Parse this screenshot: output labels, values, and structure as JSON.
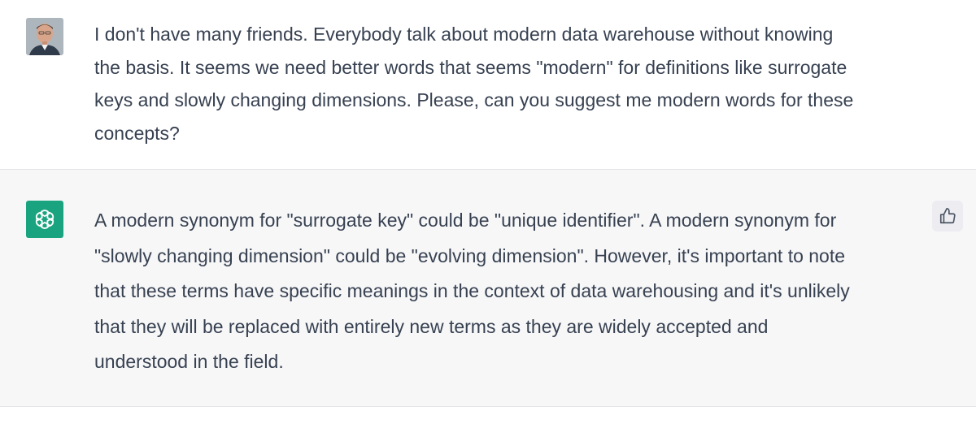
{
  "conversation": {
    "user_message": {
      "avatar_icon": "user-avatar",
      "text": "I don't have many friends. Everybody talk about modern data warehouse without knowing\nthe basis. It seems we need better words that seems \"modern\" for definitions like surrogate\nkeys and slowly changing dimensions. Please, can you suggest me modern words for these\nconcepts?"
    },
    "assistant_message": {
      "avatar_icon": "openai-logo-icon",
      "avatar_color": "#19a47f",
      "text": "A modern synonym for \"surrogate key\" could be \"unique identifier\". A modern synonym for\n\"slowly changing dimension\" could be \"evolving dimension\". However, it's important to note\nthat these terms have specific meanings in the context of data warehousing and it's unlikely\nthat they will be replaced with entirely new terms as they are widely accepted and\nunderstood in the field.",
      "feedback_icon": "thumbs-up-icon"
    }
  }
}
